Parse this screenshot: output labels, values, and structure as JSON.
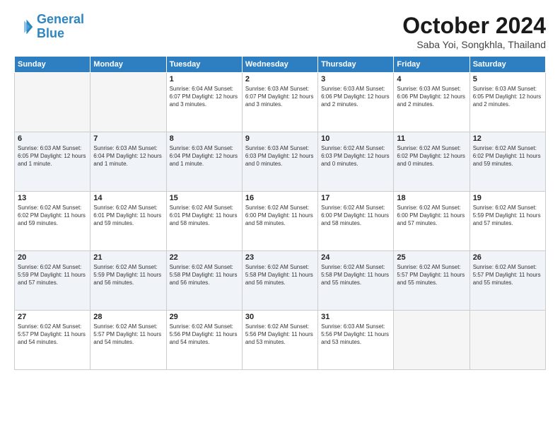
{
  "logo": {
    "line1": "General",
    "line2": "Blue"
  },
  "title": "October 2024",
  "location": "Saba Yoi, Songkhla, Thailand",
  "days_of_week": [
    "Sunday",
    "Monday",
    "Tuesday",
    "Wednesday",
    "Thursday",
    "Friday",
    "Saturday"
  ],
  "weeks": [
    [
      {
        "num": "",
        "info": ""
      },
      {
        "num": "",
        "info": ""
      },
      {
        "num": "1",
        "info": "Sunrise: 6:04 AM\nSunset: 6:07 PM\nDaylight: 12 hours\nand 3 minutes."
      },
      {
        "num": "2",
        "info": "Sunrise: 6:03 AM\nSunset: 6:07 PM\nDaylight: 12 hours\nand 3 minutes."
      },
      {
        "num": "3",
        "info": "Sunrise: 6:03 AM\nSunset: 6:06 PM\nDaylight: 12 hours\nand 2 minutes."
      },
      {
        "num": "4",
        "info": "Sunrise: 6:03 AM\nSunset: 6:06 PM\nDaylight: 12 hours\nand 2 minutes."
      },
      {
        "num": "5",
        "info": "Sunrise: 6:03 AM\nSunset: 6:05 PM\nDaylight: 12 hours\nand 2 minutes."
      }
    ],
    [
      {
        "num": "6",
        "info": "Sunrise: 6:03 AM\nSunset: 6:05 PM\nDaylight: 12 hours\nand 1 minute."
      },
      {
        "num": "7",
        "info": "Sunrise: 6:03 AM\nSunset: 6:04 PM\nDaylight: 12 hours\nand 1 minute."
      },
      {
        "num": "8",
        "info": "Sunrise: 6:03 AM\nSunset: 6:04 PM\nDaylight: 12 hours\nand 1 minute."
      },
      {
        "num": "9",
        "info": "Sunrise: 6:03 AM\nSunset: 6:03 PM\nDaylight: 12 hours\nand 0 minutes."
      },
      {
        "num": "10",
        "info": "Sunrise: 6:02 AM\nSunset: 6:03 PM\nDaylight: 12 hours\nand 0 minutes."
      },
      {
        "num": "11",
        "info": "Sunrise: 6:02 AM\nSunset: 6:02 PM\nDaylight: 12 hours\nand 0 minutes."
      },
      {
        "num": "12",
        "info": "Sunrise: 6:02 AM\nSunset: 6:02 PM\nDaylight: 11 hours\nand 59 minutes."
      }
    ],
    [
      {
        "num": "13",
        "info": "Sunrise: 6:02 AM\nSunset: 6:02 PM\nDaylight: 11 hours\nand 59 minutes."
      },
      {
        "num": "14",
        "info": "Sunrise: 6:02 AM\nSunset: 6:01 PM\nDaylight: 11 hours\nand 59 minutes."
      },
      {
        "num": "15",
        "info": "Sunrise: 6:02 AM\nSunset: 6:01 PM\nDaylight: 11 hours\nand 58 minutes."
      },
      {
        "num": "16",
        "info": "Sunrise: 6:02 AM\nSunset: 6:00 PM\nDaylight: 11 hours\nand 58 minutes."
      },
      {
        "num": "17",
        "info": "Sunrise: 6:02 AM\nSunset: 6:00 PM\nDaylight: 11 hours\nand 58 minutes."
      },
      {
        "num": "18",
        "info": "Sunrise: 6:02 AM\nSunset: 6:00 PM\nDaylight: 11 hours\nand 57 minutes."
      },
      {
        "num": "19",
        "info": "Sunrise: 6:02 AM\nSunset: 5:59 PM\nDaylight: 11 hours\nand 57 minutes."
      }
    ],
    [
      {
        "num": "20",
        "info": "Sunrise: 6:02 AM\nSunset: 5:59 PM\nDaylight: 11 hours\nand 57 minutes."
      },
      {
        "num": "21",
        "info": "Sunrise: 6:02 AM\nSunset: 5:59 PM\nDaylight: 11 hours\nand 56 minutes."
      },
      {
        "num": "22",
        "info": "Sunrise: 6:02 AM\nSunset: 5:58 PM\nDaylight: 11 hours\nand 56 minutes."
      },
      {
        "num": "23",
        "info": "Sunrise: 6:02 AM\nSunset: 5:58 PM\nDaylight: 11 hours\nand 56 minutes."
      },
      {
        "num": "24",
        "info": "Sunrise: 6:02 AM\nSunset: 5:58 PM\nDaylight: 11 hours\nand 55 minutes."
      },
      {
        "num": "25",
        "info": "Sunrise: 6:02 AM\nSunset: 5:57 PM\nDaylight: 11 hours\nand 55 minutes."
      },
      {
        "num": "26",
        "info": "Sunrise: 6:02 AM\nSunset: 5:57 PM\nDaylight: 11 hours\nand 55 minutes."
      }
    ],
    [
      {
        "num": "27",
        "info": "Sunrise: 6:02 AM\nSunset: 5:57 PM\nDaylight: 11 hours\nand 54 minutes."
      },
      {
        "num": "28",
        "info": "Sunrise: 6:02 AM\nSunset: 5:57 PM\nDaylight: 11 hours\nand 54 minutes."
      },
      {
        "num": "29",
        "info": "Sunrise: 6:02 AM\nSunset: 5:56 PM\nDaylight: 11 hours\nand 54 minutes."
      },
      {
        "num": "30",
        "info": "Sunrise: 6:02 AM\nSunset: 5:56 PM\nDaylight: 11 hours\nand 53 minutes."
      },
      {
        "num": "31",
        "info": "Sunrise: 6:03 AM\nSunset: 5:56 PM\nDaylight: 11 hours\nand 53 minutes."
      },
      {
        "num": "",
        "info": ""
      },
      {
        "num": "",
        "info": ""
      }
    ]
  ]
}
